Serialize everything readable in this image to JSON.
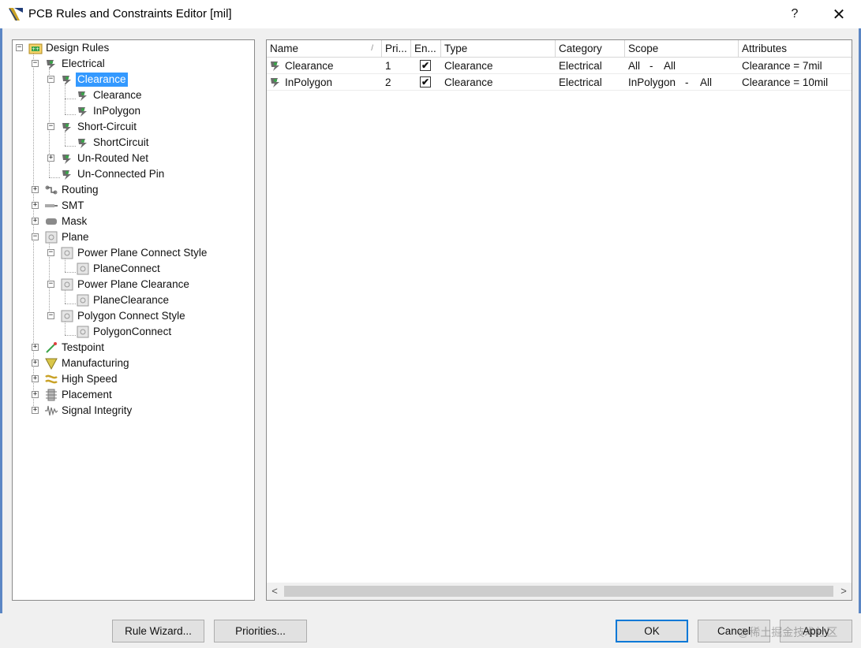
{
  "window": {
    "title": "PCB Rules and Constraints Editor [mil]",
    "help_label": "?",
    "close_label": "✕"
  },
  "tree": {
    "root": "Design Rules",
    "electrical": "Electrical",
    "clearance_group": "Clearance",
    "clearance_rule": "Clearance",
    "inpolygon_rule": "InPolygon",
    "short_circuit": "Short-Circuit",
    "shortcircuit_rule": "ShortCircuit",
    "unrouted_net": "Un-Routed Net",
    "unconnected_pin": "Un-Connected Pin",
    "routing": "Routing",
    "smt": "SMT",
    "mask": "Mask",
    "plane": "Plane",
    "power_plane_connect_style": "Power Plane Connect Style",
    "plane_connect": "PlaneConnect",
    "power_plane_clearance": "Power Plane Clearance",
    "plane_clearance": "PlaneClearance",
    "polygon_connect_style": "Polygon Connect Style",
    "polygon_connect": "PolygonConnect",
    "testpoint": "Testpoint",
    "manufacturing": "Manufacturing",
    "high_speed": "High Speed",
    "placement": "Placement",
    "signal_integrity": "Signal Integrity"
  },
  "grid": {
    "columns": [
      "Name",
      "Pri...",
      "En...",
      "Type",
      "Category",
      "Scope",
      "Attributes"
    ],
    "sort_indicator": "/",
    "rows": [
      {
        "name": "Clearance",
        "priority": "1",
        "enabled": "✔",
        "type": "Clearance",
        "category": "Electrical",
        "scope_a": "All",
        "scope_sep": "-",
        "scope_b": "All",
        "attributes": "Clearance = 7mil"
      },
      {
        "name": "InPolygon",
        "priority": "2",
        "enabled": "✔",
        "type": "Clearance",
        "category": "Electrical",
        "scope_a": "InPolygon",
        "scope_sep": "-",
        "scope_b": "All",
        "attributes": "Clearance = 10mil"
      }
    ],
    "scroll_left": "<",
    "scroll_right": ">"
  },
  "buttons": {
    "rule_wizard": "Rule Wizard...",
    "priorities": "Priorities...",
    "ok": "OK",
    "cancel": "Cancel",
    "apply": "Apply"
  },
  "watermark": "@稀土掘金技术社区",
  "colors": {
    "selection": "#3399ff",
    "default_button_border": "#0078d7",
    "window_border": "#5b86c4"
  }
}
